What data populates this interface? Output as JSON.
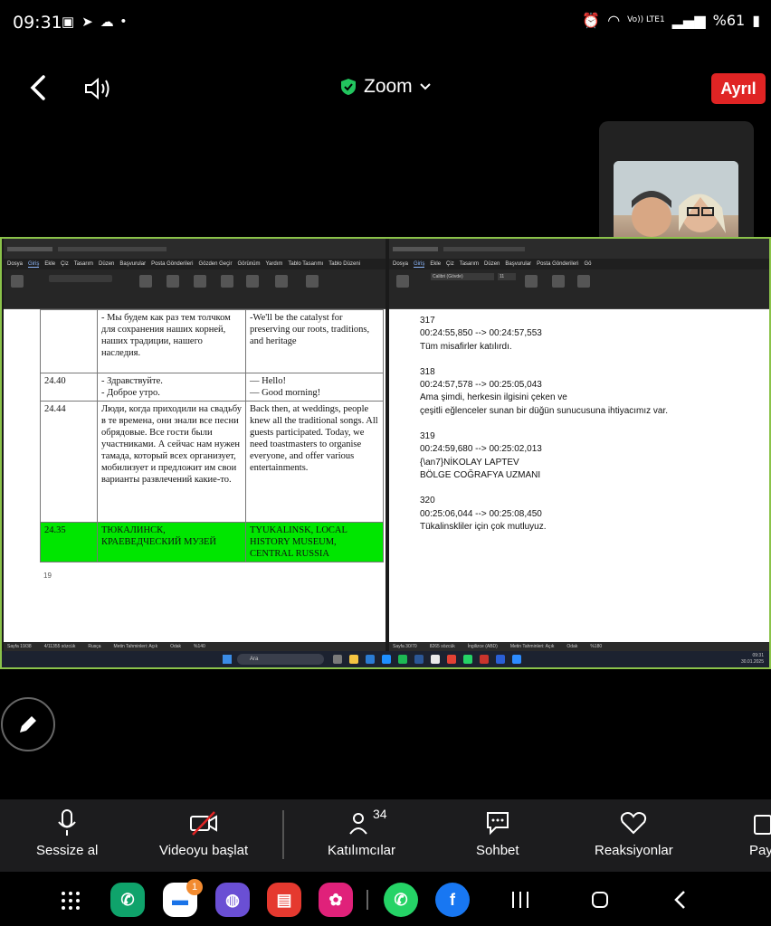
{
  "status_bar": {
    "time": "09:31",
    "battery": "%61",
    "network": "Vo)) LTE1"
  },
  "header": {
    "title": "Zoom",
    "leave_label": "Ayrıl"
  },
  "left_window": {
    "menu": [
      "Dosya",
      "Giriş",
      "Ekle",
      "Çiz",
      "Tasarım",
      "Düzen",
      "Başvurular",
      "Posta Gönderileri",
      "Gözden Geçir",
      "Görünüm",
      "Yardım",
      "Tablo Tasarımı",
      "Tablo Düzeni"
    ],
    "rows": [
      {
        "tc": "",
        "ru": "- Мы будем как раз тем толчком для сохранения наших корней, наших традиции, нашего наследия.",
        "en": "-We'll be the catalyst for preserving our roots, traditions, and heritage",
        "green": false
      },
      {
        "tc": "24.40",
        "ru": "- Здравствуйте.\n- Доброе утро.",
        "en": "— Hello!\n— Good morning!",
        "green": false
      },
      {
        "tc": "24.44",
        "ru": "Люди, когда приходили на свадьбу в те времена, они знали все песни обрядовые. Все гости были участниками. А сейчас нам нужен тамада, который всех организует, мобилизует и предложит им свои варианты развлечений какие-то.",
        "en": "Back then, at weddings, people knew all the traditional songs. All guests participated. Today, we need toastmasters to organise everyone, and offer various entertainments.",
        "green": false
      },
      {
        "tc": "24.35",
        "ru": "ТЮКАЛИНСК, КРАЕВЕДЧЕСКИЙ МУЗЕЙ",
        "en": "TYUKALINSK, LOCAL HISTORY MUSEUM, CENTRAL RUSSIA",
        "green": true
      }
    ],
    "page_number": "19",
    "status": [
      "Sayfa 19/38",
      "4/11355 sözcük",
      "Rusça",
      "Metin Tahminleri: Açık",
      "Odak",
      "%140"
    ]
  },
  "right_window": {
    "menu": [
      "Dosya",
      "Giriş",
      "Ekle",
      "Çiz",
      "Tasarım",
      "Düzen",
      "Başvurular",
      "Posta Gönderileri",
      "Gö"
    ],
    "font": "Calibri (Gövde)",
    "font_size": "11",
    "subtitles": [
      {
        "index": "317",
        "time": "00:24:55,850 --> 00:24:57,553",
        "lines": [
          "Tüm misafirler katılırdı."
        ]
      },
      {
        "index": "318",
        "time": "00:24:57,578 --> 00:25:05,043",
        "lines": [
          "Ama şimdi, herkesin ilgisini çeken ve",
          "çeşitli eğlenceler sunan bir düğün sunucusuna ihtiyacımız var."
        ]
      },
      {
        "index": "319",
        "time": "00:24:59,680 --> 00:25:02,013",
        "lines": [
          "{\\an7}NİKOLAY LAPTEV",
          "BÖLGE COĞRAFYA UZMANI"
        ]
      },
      {
        "index": "320",
        "time": "00:25:06,044 --> 00:25:08,450",
        "lines": [
          "Tükalinskliler için çok mutluyuz."
        ]
      }
    ],
    "status": [
      "Sayfa 30/70",
      "8265 sözcük",
      "İngilizce (ABD)",
      "Metin Tahminleri: Açık",
      "Odak",
      "%180"
    ]
  },
  "taskbar": {
    "search_placeholder": "Ara",
    "clock_time": "09:31",
    "clock_date": "30.01.2025"
  },
  "toolbar": {
    "mute": "Sessize al",
    "video": "Videoyu başlat",
    "participants": "Katılımcılar",
    "participant_count": "34",
    "chat": "Sohbet",
    "reactions": "Reaksiyonlar",
    "more": "Pay"
  },
  "nav": {
    "messages_badge": "1"
  }
}
